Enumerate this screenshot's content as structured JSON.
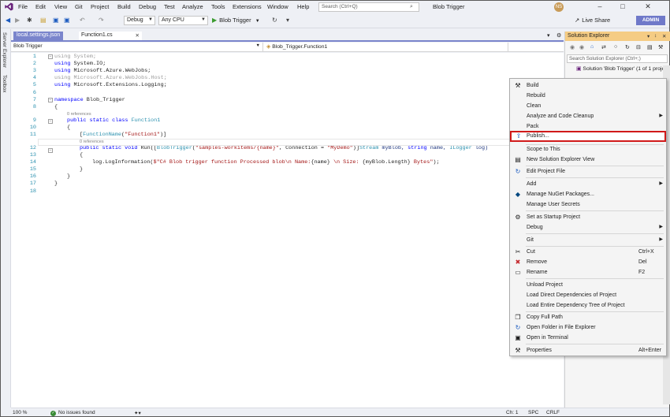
{
  "menubar": {
    "items": [
      "File",
      "Edit",
      "View",
      "Git",
      "Project",
      "Build",
      "Debug",
      "Test",
      "Analyze",
      "Tools",
      "Extensions",
      "Window",
      "Help"
    ],
    "search_placeholder": "Search (Ctrl+Q)",
    "window_title": "Blob Trigger",
    "avatar_initials": "NS"
  },
  "toolbar": {
    "config": "Debug",
    "platform": "Any CPU",
    "run_label": "Blob Trigger",
    "live_share": "Live Share",
    "admin": "ADMIN"
  },
  "side_tabs": [
    "Server Explorer",
    "Toolbox"
  ],
  "tabs": [
    {
      "label": "local.settings.json"
    },
    {
      "label": "Function1.cs"
    }
  ],
  "navbar": {
    "project": "Blob Trigger",
    "member": "Blob_Trigger.Function1"
  },
  "code": {
    "line_numbers": [
      "1",
      "2",
      "3",
      "4",
      "5",
      "6",
      "7",
      "8",
      "9",
      "10",
      "11",
      "12",
      "13",
      "14",
      "15",
      "16",
      "17",
      "18"
    ],
    "l1a": "using ",
    "l1b": "System;",
    "l2a": "using ",
    "l2b": "System.IO;",
    "l3a": "using ",
    "l3b": "Microsoft.Azure.WebJobs;",
    "l4a": "using ",
    "l4b": "Microsoft.Azure.WebJobs.Host;",
    "l5a": "using ",
    "l5b": "Microsoft.Extensions.Logging;",
    "l7a": "namespace ",
    "l7b": "Blob_Trigger",
    "l8": "{",
    "ref1": "0 references",
    "l9a": "public static class ",
    "l9b": "Function1",
    "l10": "{",
    "l11a": "[",
    "l11b": "FunctionName",
    "l11c": "(",
    "l11d": "\"Function1\"",
    "l11e": ")]",
    "ref2": "0 references",
    "l12a": "public static void ",
    "l12b": "Run([",
    "l12c": "BlobTrigger",
    "l12d": "(",
    "l12e": "\"samples-workitems/{name}\"",
    "l12f": ", Connection = ",
    "l12g": "\"MyDemo\"",
    "l12h": ")]",
    "l12i": "Stream ",
    "l12j": "myBlob, ",
    "l12k": "string ",
    "l12l": "name, ",
    "l12m": "ILogger ",
    "l12n": "log)",
    "l13": "{",
    "l14a": "log.LogInformation(",
    "l14b": "$\"C# Blob trigger function Processed blob\\n Name:",
    "l14c": "{name}",
    "l14d": " \\n Size: ",
    "l14e": "{myBlob.Length}",
    "l14f": " Bytes\"",
    ");": ");",
    "l15": "}",
    "l16": "}",
    "l17": "}"
  },
  "status": {
    "zoom": "100 %",
    "issues": "No issues found",
    "position": "Ch: 1",
    "mode1": "SPC",
    "mode2": "CRLF"
  },
  "solution_explorer": {
    "title": "Solution Explorer",
    "search_placeholder": "Search Solution Explorer (Ctrl+;)",
    "solution_label": "Solution 'Blob Trigger' (1 of 1 proje"
  },
  "context_menu": {
    "build": "Build",
    "rebuild": "Rebuild",
    "clean": "Clean",
    "analyze": "Analyze and Code Cleanup",
    "pack": "Pack",
    "publish": "Publish...",
    "scope": "Scope to This",
    "new_view": "New Solution Explorer View",
    "edit_project": "Edit Project File",
    "add": "Add",
    "nuget": "Manage NuGet Packages...",
    "secrets": "Manage User Secrets",
    "startup": "Set as Startup Project",
    "debug": "Debug",
    "git": "Git",
    "cut": "Cut",
    "cut_sc": "Ctrl+X",
    "remove": "Remove",
    "remove_sc": "Del",
    "rename": "Rename",
    "rename_sc": "F2",
    "unload": "Unload Project",
    "load_direct": "Load Direct Dependencies of Project",
    "load_tree": "Load Entire Dependency Tree of Project",
    "copy_path": "Copy Full Path",
    "open_folder": "Open Folder in File Explorer",
    "open_terminal": "Open in Terminal",
    "properties": "Properties",
    "properties_sc": "Alt+Enter"
  },
  "colors": {
    "accent": "#7a85cc",
    "publish_highlight": "#d11a1a",
    "se_title": "#f5cc84",
    "admin": "#6f79c9"
  }
}
